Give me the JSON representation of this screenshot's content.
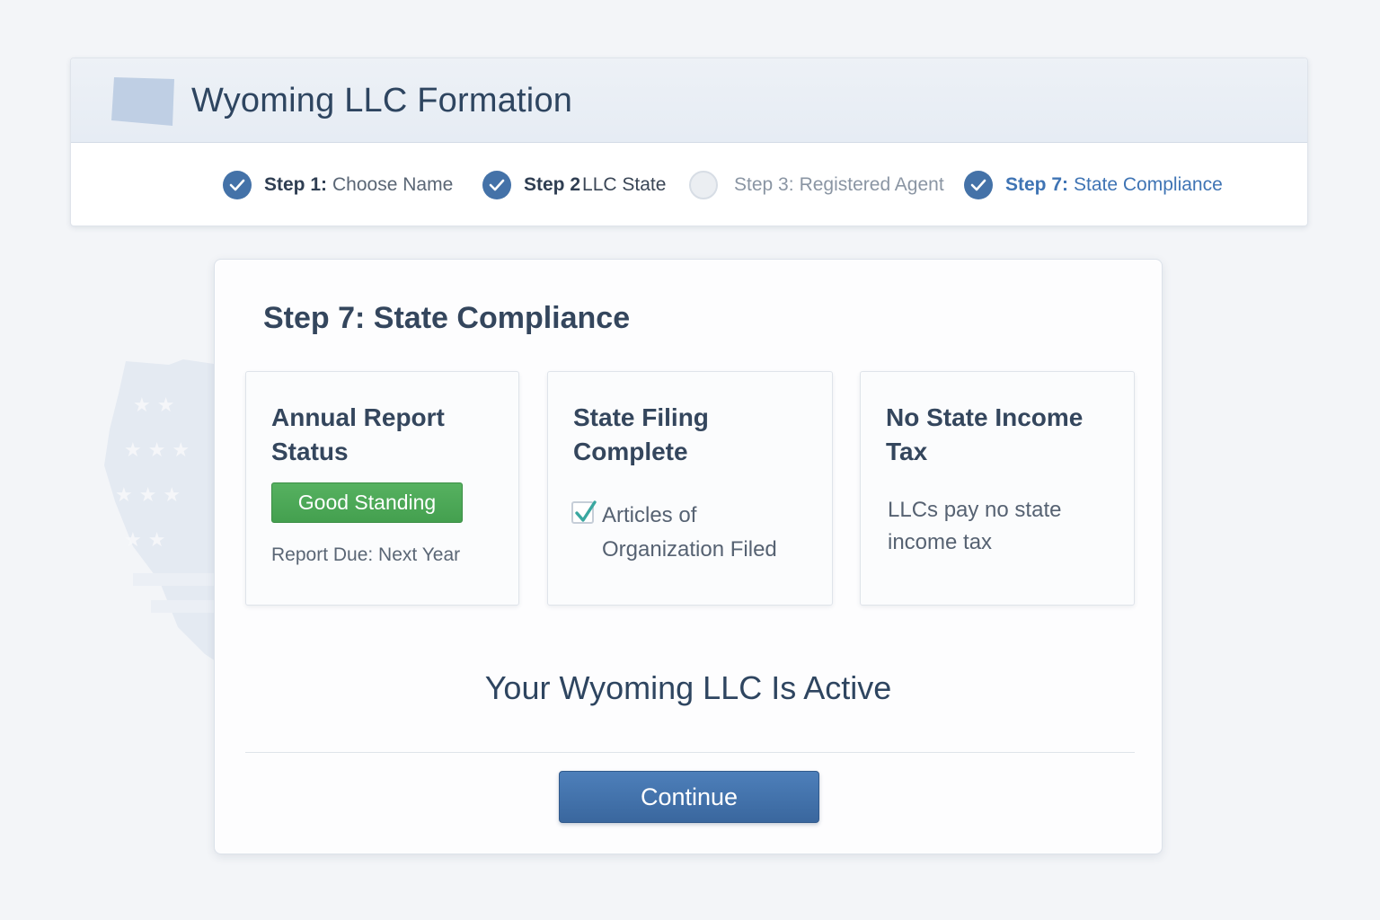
{
  "header": {
    "title": "Wyoming LLC Formation",
    "logo_icon": "wyoming-state-shape-icon"
  },
  "stepper": {
    "steps": [
      {
        "number": "Step 1:",
        "name": "Choose Name",
        "status": "complete"
      },
      {
        "number": "Step 2",
        "name": "LLC State",
        "status": "complete"
      },
      {
        "number": "Step 3:",
        "name": "Registered Agent",
        "status": "pending"
      },
      {
        "number": "Step 7:",
        "name": "State Compliance",
        "status": "current"
      }
    ]
  },
  "main": {
    "title": "Step 7: State Compliance",
    "cards": {
      "annual_report": {
        "title": "Annual Report Status",
        "badge": "Good Standing",
        "due": "Report Due: Next Year"
      },
      "state_filing": {
        "title": "State Filing Complete",
        "item": "Articles of Organization Filed",
        "checked": true
      },
      "income_tax": {
        "title": "No State Income Tax",
        "text": "LLCs pay no state income tax"
      }
    },
    "status_message": "Your Wyoming LLC Is Active",
    "continue_label": "Continue"
  },
  "colors": {
    "accent": "#4472a8",
    "success": "#48a452",
    "button": "#4272ab"
  }
}
